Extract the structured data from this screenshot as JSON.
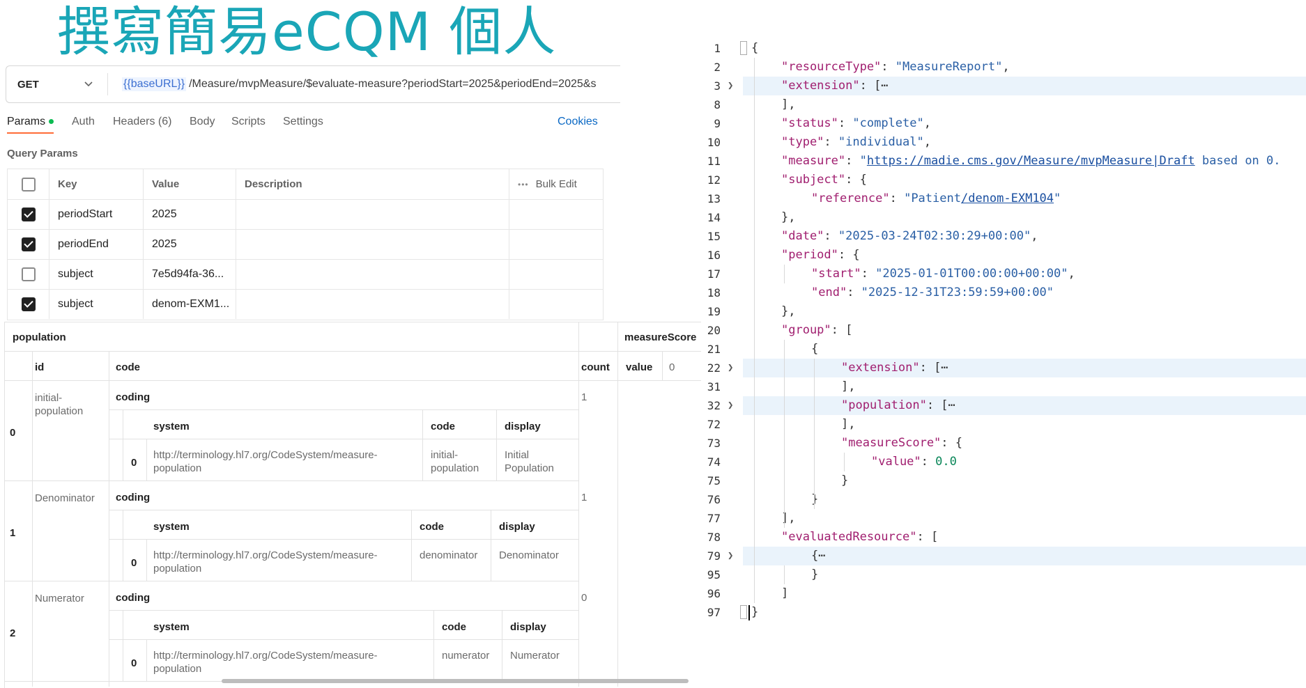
{
  "slide": {
    "title": "撰寫簡易eCQM 個人"
  },
  "request": {
    "method": "GET",
    "url_variable": "{{baseURL}}",
    "url_path": "/Measure/mvpMeasure/$evaluate-measure?periodStart=2025&periodEnd=2025&s"
  },
  "tabs": [
    "Params",
    "Auth",
    "Headers (6)",
    "Body",
    "Scripts",
    "Settings"
  ],
  "cookies_label": "Cookies",
  "query_params": {
    "label": "Query Params",
    "headers": {
      "key": "Key",
      "value": "Value",
      "description": "Description",
      "bulk_edit": "Bulk Edit"
    },
    "rows": [
      {
        "checked": true,
        "key": "periodStart",
        "value": "2025",
        "description": ""
      },
      {
        "checked": true,
        "key": "periodEnd",
        "value": "2025",
        "description": ""
      },
      {
        "checked": false,
        "key": "subject",
        "value": "7e5d94fa-36...",
        "description": ""
      },
      {
        "checked": true,
        "key": "subject",
        "value": "denom-EXM1...",
        "description": ""
      }
    ]
  },
  "grid": {
    "population_header": "population",
    "measure_score_header": "measureScore",
    "col_id": "id",
    "col_code": "code",
    "col_count": "count",
    "value_label": "value",
    "score_value": "0",
    "coding_label": "coding",
    "sub_system": "system",
    "sub_code": "code",
    "sub_display": "display",
    "rows": [
      {
        "index": "0",
        "id": "initial-population",
        "count": "1",
        "sub_index": "0",
        "system": "http://terminology.hl7.org/CodeSystem/measure-population",
        "code": "initial-population",
        "display": "Initial Population"
      },
      {
        "index": "1",
        "id": "Denominator",
        "count": "1",
        "sub_index": "0",
        "system": "http://terminology.hl7.org/CodeSystem/measure-population",
        "code": "denominator",
        "display": "Denominator"
      },
      {
        "index": "2",
        "id": "Numerator",
        "count": "0",
        "sub_index": "0",
        "system": "http://terminology.hl7.org/CodeSystem/measure-population",
        "code": "numerator",
        "display": "Numerator"
      }
    ]
  },
  "code": {
    "lines": [
      {
        "n": "1",
        "indent": 0,
        "parts": [
          [
            "p",
            "{"
          ]
        ]
      },
      {
        "n": "2",
        "indent": 1,
        "parts": [
          [
            "k",
            "\"resourceType\""
          ],
          [
            "p",
            ": "
          ],
          [
            "s",
            "\"MeasureReport\""
          ],
          [
            "p",
            ","
          ]
        ]
      },
      {
        "n": "3",
        "indent": 1,
        "fold": true,
        "hl": true,
        "parts": [
          [
            "k",
            "\"extension\""
          ],
          [
            "p",
            ": [⋯"
          ]
        ]
      },
      {
        "n": "8",
        "indent": 1,
        "parts": [
          [
            "p",
            "],"
          ]
        ]
      },
      {
        "n": "9",
        "indent": 1,
        "parts": [
          [
            "k",
            "\"status\""
          ],
          [
            "p",
            ": "
          ],
          [
            "s",
            "\"complete\""
          ],
          [
            "p",
            ","
          ]
        ]
      },
      {
        "n": "10",
        "indent": 1,
        "parts": [
          [
            "k",
            "\"type\""
          ],
          [
            "p",
            ": "
          ],
          [
            "s",
            "\"individual\""
          ],
          [
            "p",
            ","
          ]
        ]
      },
      {
        "n": "11",
        "indent": 1,
        "parts": [
          [
            "k",
            "\"measure\""
          ],
          [
            "p",
            ": "
          ],
          [
            "s",
            "\""
          ],
          [
            "l",
            "https://madie.cms.gov/Measure/mvpMeasure|Draft"
          ],
          [
            "s",
            " based on 0."
          ]
        ]
      },
      {
        "n": "12",
        "indent": 1,
        "parts": [
          [
            "k",
            "\"subject\""
          ],
          [
            "p",
            ": {"
          ]
        ]
      },
      {
        "n": "13",
        "indent": 2,
        "parts": [
          [
            "k",
            "\"reference\""
          ],
          [
            "p",
            ": "
          ],
          [
            "s",
            "\"Patient"
          ],
          [
            "l",
            "/denom-EXM104"
          ],
          [
            "s",
            "\""
          ]
        ]
      },
      {
        "n": "14",
        "indent": 1,
        "parts": [
          [
            "p",
            "},"
          ]
        ]
      },
      {
        "n": "15",
        "indent": 1,
        "parts": [
          [
            "k",
            "\"date\""
          ],
          [
            "p",
            ": "
          ],
          [
            "s",
            "\"2025-03-24T02:30:29+00:00\""
          ],
          [
            "p",
            ","
          ]
        ]
      },
      {
        "n": "16",
        "indent": 1,
        "parts": [
          [
            "k",
            "\"period\""
          ],
          [
            "p",
            ": {"
          ]
        ]
      },
      {
        "n": "17",
        "indent": 2,
        "parts": [
          [
            "k",
            "\"start\""
          ],
          [
            "p",
            ": "
          ],
          [
            "s",
            "\"2025-01-01T00:00:00+00:00\""
          ],
          [
            "p",
            ","
          ]
        ]
      },
      {
        "n": "18",
        "indent": 2,
        "parts": [
          [
            "k",
            "\"end\""
          ],
          [
            "p",
            ": "
          ],
          [
            "s",
            "\"2025-12-31T23:59:59+00:00\""
          ]
        ]
      },
      {
        "n": "19",
        "indent": 1,
        "parts": [
          [
            "p",
            "},"
          ]
        ]
      },
      {
        "n": "20",
        "indent": 1,
        "parts": [
          [
            "k",
            "\"group\""
          ],
          [
            "p",
            ": ["
          ]
        ]
      },
      {
        "n": "21",
        "indent": 2,
        "parts": [
          [
            "p",
            "{"
          ]
        ]
      },
      {
        "n": "22",
        "indent": 3,
        "fold": true,
        "hl": true,
        "parts": [
          [
            "k",
            "\"extension\""
          ],
          [
            "p",
            ": [⋯"
          ]
        ]
      },
      {
        "n": "31",
        "indent": 3,
        "parts": [
          [
            "p",
            "],"
          ]
        ]
      },
      {
        "n": "32",
        "indent": 3,
        "fold": true,
        "hl": true,
        "parts": [
          [
            "k",
            "\"population\""
          ],
          [
            "p",
            ": [⋯"
          ]
        ]
      },
      {
        "n": "72",
        "indent": 3,
        "parts": [
          [
            "p",
            "],"
          ]
        ]
      },
      {
        "n": "73",
        "indent": 3,
        "parts": [
          [
            "k",
            "\"measureScore\""
          ],
          [
            "p",
            ": {"
          ]
        ]
      },
      {
        "n": "74",
        "indent": 4,
        "parts": [
          [
            "k",
            "\"value\""
          ],
          [
            "p",
            ": "
          ],
          [
            "n",
            "0.0"
          ]
        ]
      },
      {
        "n": "75",
        "indent": 3,
        "parts": [
          [
            "p",
            "}"
          ]
        ]
      },
      {
        "n": "76",
        "indent": 2,
        "parts": [
          [
            "p",
            "}"
          ]
        ]
      },
      {
        "n": "77",
        "indent": 1,
        "parts": [
          [
            "p",
            "],"
          ]
        ]
      },
      {
        "n": "78",
        "indent": 1,
        "parts": [
          [
            "k",
            "\"evaluatedResource\""
          ],
          [
            "p",
            ": ["
          ]
        ]
      },
      {
        "n": "79",
        "indent": 2,
        "fold": true,
        "hl": true,
        "parts": [
          [
            "p",
            "{⋯"
          ]
        ]
      },
      {
        "n": "95",
        "indent": 2,
        "parts": [
          [
            "p",
            "}"
          ]
        ]
      },
      {
        "n": "96",
        "indent": 1,
        "parts": [
          [
            "p",
            "]"
          ]
        ]
      },
      {
        "n": "97",
        "indent": 0,
        "parts": [
          [
            "p",
            "}"
          ]
        ]
      }
    ]
  }
}
